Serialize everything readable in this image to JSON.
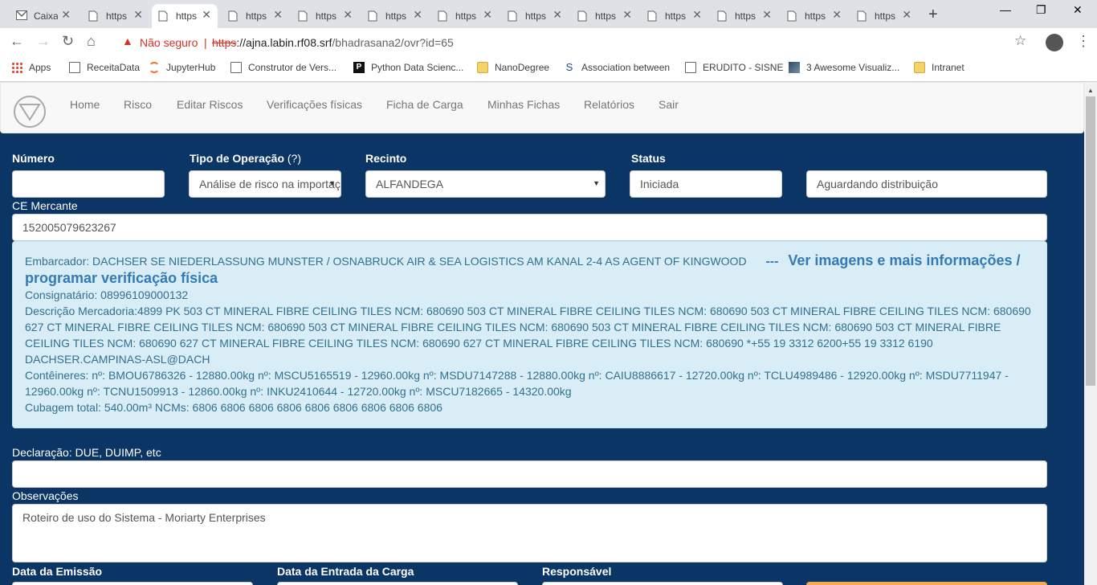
{
  "browser": {
    "tabs": [
      {
        "title": "Caixa",
        "icon": "gmail-icon"
      },
      {
        "title": "https",
        "icon": "page-icon"
      },
      {
        "title": "https",
        "icon": "page-icon",
        "active": true
      },
      {
        "title": "https",
        "icon": "page-icon"
      },
      {
        "title": "https",
        "icon": "page-icon"
      },
      {
        "title": "https",
        "icon": "page-icon"
      },
      {
        "title": "https",
        "icon": "page-icon"
      },
      {
        "title": "https",
        "icon": "page-icon"
      },
      {
        "title": "https",
        "icon": "page-icon"
      },
      {
        "title": "https",
        "icon": "page-icon"
      },
      {
        "title": "https",
        "icon": "page-icon"
      },
      {
        "title": "https",
        "icon": "page-icon"
      },
      {
        "title": "https",
        "icon": "page-icon"
      }
    ],
    "not_secure": "Não seguro",
    "url_scheme": "https",
    "url_host": "://ajna.labin.rf08.srf",
    "url_path": "/bhadrasana2/ovr?id=65",
    "bookmarks": [
      {
        "label": "Apps",
        "icon": "apps-icon"
      },
      {
        "label": "ReceitaData",
        "icon": "page-icon"
      },
      {
        "label": "JupyterHub",
        "icon": "jupyter-icon"
      },
      {
        "label": "Construtor de Vers...",
        "icon": "page-icon"
      },
      {
        "label": "Python Data Scienc...",
        "icon": "p-icon"
      },
      {
        "label": "NanoDegree",
        "icon": "folder-icon"
      },
      {
        "label": "Association between",
        "icon": "dna-icon"
      },
      {
        "label": "ERUDITO - SISNE",
        "icon": "page-icon"
      },
      {
        "label": "3 Awesome Visualiz...",
        "icon": "image-icon"
      },
      {
        "label": "Intranet",
        "icon": "folder-icon"
      }
    ]
  },
  "nav": {
    "links": [
      "Home",
      "Risco",
      "Editar Riscos",
      "Verificações físicas",
      "Ficha de Carga",
      "Minhas Fichas",
      "Relatórios",
      "Sair"
    ]
  },
  "form": {
    "numero_label": "Número",
    "numero_value": "",
    "tipo_label": "Tipo de Operação",
    "tipo_hint": "(?)",
    "tipo_value": "Análise de risco na importação",
    "recinto_label": "Recinto",
    "recinto_value": "ALFANDEGA",
    "status_label": "Status",
    "status_value": "Iniciada",
    "fase_value": "Aguardando distribuição",
    "ce_label": "CE Mercante",
    "ce_value": "152005079623267",
    "declaracao_label": "Declaração: DUE, DUIMP, etc",
    "declaracao_value": "",
    "observacoes_label": "Observações",
    "observacoes_value": "Roteiro de uso do Sistema - Moriarty Enterprises",
    "data_emissao_label": "Data da Emissão",
    "data_entrada_label": "Data da Entrada da Carga",
    "responsavel_label": "Responsável"
  },
  "info": {
    "embarcador": "Embarcador: DACHSER SE NIEDERLASSUNG MUNSTER / OSNABRUCK AIR & SEA LOGISTICS AM KANAL 2-4 AS AGENT OF KINGWOOD",
    "separator": "---",
    "link": "Ver imagens e mais informações / programar verificação física",
    "consignatario": "Consignatário: 08996109000132",
    "descricao": "Descrição Mercadoria:4899 PK 503 CT MINERAL FIBRE CEILING TILES NCM: 680690 503 CT MINERAL FIBRE CEILING TILES NCM: 680690 503 CT MINERAL FIBRE CEILING TILES NCM: 680690 627 CT MINERAL FIBRE CEILING TILES NCM: 680690 503 CT MINERAL FIBRE CEILING TILES NCM: 680690 503 CT MINERAL FIBRE CEILING TILES NCM: 680690 503 CT MINERAL FIBRE CEILING TILES NCM: 680690 627 CT MINERAL FIBRE CEILING TILES NCM: 680690 627 CT MINERAL FIBRE CEILING TILES NCM: 680690 *+55 19 3312 6200+55 19 3312 6190 DACHSER.CAMPINAS-ASL@DACH",
    "conteineres": "Contêineres: nº: BMOU6786326 - 12880.00kg nº: MSCU5165519 - 12960.00kg nº: MSDU7147288 - 12880.00kg nº: CAIU8886617 - 12720.00kg nº: TCLU4989486 - 12920.00kg nº: MSDU7711947 - 12960.00kg nº: TCNU1509913 - 12860.00kg nº: INKU2410644 - 12720.00kg nº: MSCU7182665 - 14320.00kg",
    "cubagem": "Cubagem total: 540.00m³ NCMs: 6806 6806 6806 6806 6806 6806 6806 6806 6806"
  },
  "colors": {
    "page_bg": "#0b3564",
    "info_bg": "#d9edf7",
    "info_text": "#31708f",
    "link": "#337ab7",
    "insecure": "#d93025"
  }
}
